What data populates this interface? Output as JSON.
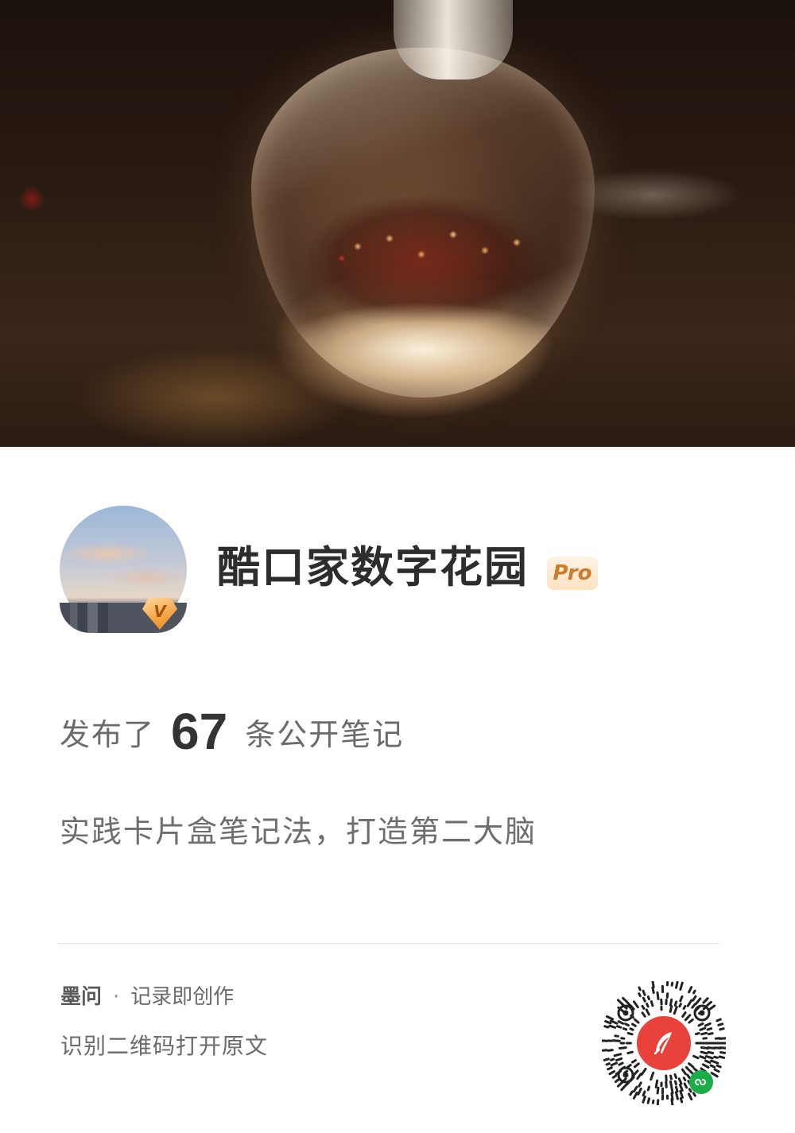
{
  "profile": {
    "name": "酷口家数字花园",
    "pro_label": "Pro",
    "verified_label": "V"
  },
  "stats": {
    "prefix": "发布了",
    "count": "67",
    "suffix": "条公开笔记"
  },
  "description": "实践卡片盒笔记法，打造第二大脑",
  "footer": {
    "brand": "墨问",
    "separator": "·",
    "slogan": "记录即创作",
    "scan_hint": "识别二维码打开原文"
  },
  "icons": {
    "verified": "v-badge-icon",
    "pro": "pro-badge",
    "qr_logo": "feather-icon",
    "mini_program": "mini-program-icon"
  },
  "colors": {
    "qr_logo_bg": "#e8423a",
    "mini_program": "#1aad48",
    "pro_text": "#d07a2c",
    "badge_gold": "#f4a23f"
  }
}
